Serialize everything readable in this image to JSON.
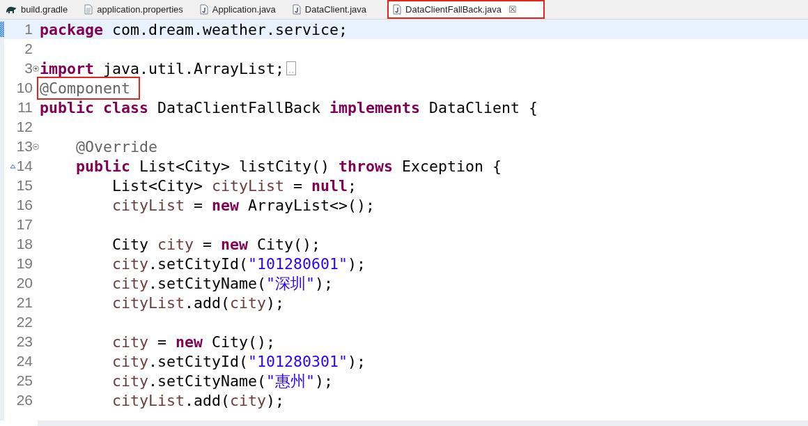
{
  "tabs": [
    {
      "label": "build.gradle",
      "kind": "gradle",
      "selected": false,
      "boxed": false
    },
    {
      "label": "application.properties",
      "kind": "text",
      "selected": false,
      "boxed": false
    },
    {
      "label": "Application.java",
      "kind": "java",
      "selected": false,
      "boxed": false
    },
    {
      "label": "DataClient.java",
      "kind": "java",
      "selected": false,
      "boxed": false
    },
    {
      "label": "DataClientFallBack.java",
      "kind": "java",
      "selected": true,
      "boxed": true,
      "close": "☒"
    }
  ],
  "editor": {
    "lines": [
      {
        "number": "1",
        "current": true,
        "tokens": [
          {
            "kind": "kw",
            "t": "package"
          },
          {
            "kind": "plain",
            "t": " com.dream.weather.service;"
          }
        ]
      },
      {
        "number": "2"
      },
      {
        "number": "3",
        "fold_expanded": false,
        "folded": true,
        "tokens": [
          {
            "kind": "kw",
            "t": "import"
          },
          {
            "kind": "plain",
            "t": " java.util.ArrayList;"
          }
        ]
      },
      {
        "number": "10",
        "tokens": [
          {
            "kind": "ann",
            "t": "@Component",
            "boxed": true
          }
        ]
      },
      {
        "number": "11",
        "tokens": [
          {
            "kind": "kw",
            "t": "public class"
          },
          {
            "kind": "plain",
            "t": " DataClientFallBack "
          },
          {
            "kind": "kw",
            "t": "implements"
          },
          {
            "kind": "plain",
            "t": " DataClient {"
          }
        ]
      },
      {
        "number": "12"
      },
      {
        "number": "13",
        "fold_expanded": true,
        "tokens": [
          {
            "kind": "ann",
            "t": "    @Override"
          }
        ]
      },
      {
        "number": "14",
        "override": true,
        "tokens": [
          {
            "kind": "kw",
            "t": "    public"
          },
          {
            "kind": "plain",
            "t": " List<City> listCity() "
          },
          {
            "kind": "kw",
            "t": "throws"
          },
          {
            "kind": "plain",
            "t": " Exception {"
          }
        ]
      },
      {
        "number": "15",
        "tokens": [
          {
            "kind": "plain",
            "t": "        List<City> "
          },
          {
            "kind": "var",
            "t": "cityList"
          },
          {
            "kind": "plain",
            "t": " = "
          },
          {
            "kind": "kw",
            "t": "null"
          },
          {
            "kind": "plain",
            "t": ";"
          }
        ]
      },
      {
        "number": "16",
        "tokens": [
          {
            "kind": "var",
            "t": "        cityList"
          },
          {
            "kind": "plain",
            "t": " = "
          },
          {
            "kind": "kw",
            "t": "new"
          },
          {
            "kind": "plain",
            "t": " ArrayList<>();"
          }
        ]
      },
      {
        "number": "17"
      },
      {
        "number": "18",
        "tokens": [
          {
            "kind": "plain",
            "t": "        City "
          },
          {
            "kind": "var",
            "t": "city"
          },
          {
            "kind": "plain",
            "t": " = "
          },
          {
            "kind": "kw",
            "t": "new"
          },
          {
            "kind": "plain",
            "t": " City();"
          }
        ]
      },
      {
        "number": "19",
        "tokens": [
          {
            "kind": "var",
            "t": "        city"
          },
          {
            "kind": "plain",
            "t": ".setCityId("
          },
          {
            "kind": "str",
            "t": "\"101280601\""
          },
          {
            "kind": "plain",
            "t": ");"
          }
        ]
      },
      {
        "number": "20",
        "tokens": [
          {
            "kind": "var",
            "t": "        city"
          },
          {
            "kind": "plain",
            "t": ".setCityName("
          },
          {
            "kind": "str",
            "t": "\"深圳\""
          },
          {
            "kind": "plain",
            "t": ");"
          }
        ]
      },
      {
        "number": "21",
        "tokens": [
          {
            "kind": "var",
            "t": "        cityList"
          },
          {
            "kind": "plain",
            "t": ".add("
          },
          {
            "kind": "var",
            "t": "city"
          },
          {
            "kind": "plain",
            "t": ");"
          }
        ]
      },
      {
        "number": "22"
      },
      {
        "number": "23",
        "tokens": [
          {
            "kind": "var",
            "t": "        city"
          },
          {
            "kind": "plain",
            "t": " = "
          },
          {
            "kind": "kw",
            "t": "new"
          },
          {
            "kind": "plain",
            "t": " City();"
          }
        ]
      },
      {
        "number": "24",
        "tokens": [
          {
            "kind": "var",
            "t": "        city"
          },
          {
            "kind": "plain",
            "t": ".setCityId("
          },
          {
            "kind": "str",
            "t": "\"101280301\""
          },
          {
            "kind": "plain",
            "t": ");"
          }
        ]
      },
      {
        "number": "25",
        "tokens": [
          {
            "kind": "var",
            "t": "        city"
          },
          {
            "kind": "plain",
            "t": ".setCityName("
          },
          {
            "kind": "str",
            "t": "\"惠州\""
          },
          {
            "kind": "plain",
            "t": ");"
          }
        ]
      },
      {
        "number": "26",
        "tokens": [
          {
            "kind": "var",
            "t": "        cityList"
          },
          {
            "kind": "plain",
            "t": ".add("
          },
          {
            "kind": "var",
            "t": "city"
          },
          {
            "kind": "plain",
            "t": ");"
          }
        ]
      }
    ]
  }
}
